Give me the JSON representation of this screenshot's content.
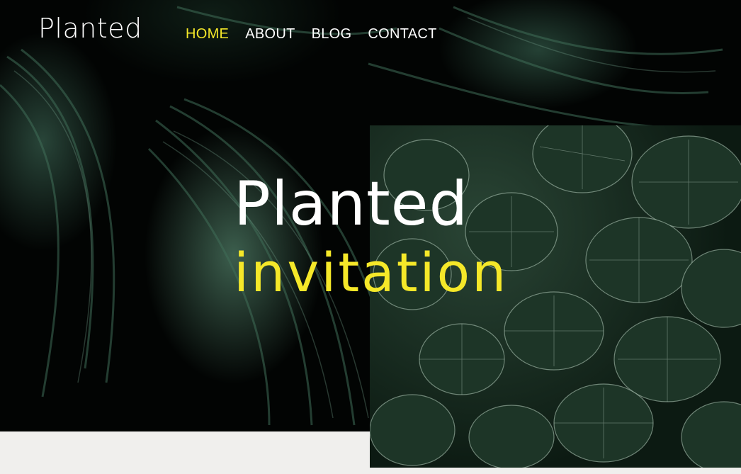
{
  "brand": {
    "logo": "Planted"
  },
  "nav": {
    "items": [
      {
        "label": "HOME",
        "active": true
      },
      {
        "label": "ABOUT",
        "active": false
      },
      {
        "label": "BLOG",
        "active": false
      },
      {
        "label": "CONTACT",
        "active": false
      }
    ]
  },
  "hero": {
    "title_line1": "Planted",
    "title_line2": "invitation"
  },
  "colors": {
    "accent": "#f5e829",
    "background_dark": "#020403",
    "foliage": "#2f4f3e",
    "page_bg": "#f0efed"
  }
}
